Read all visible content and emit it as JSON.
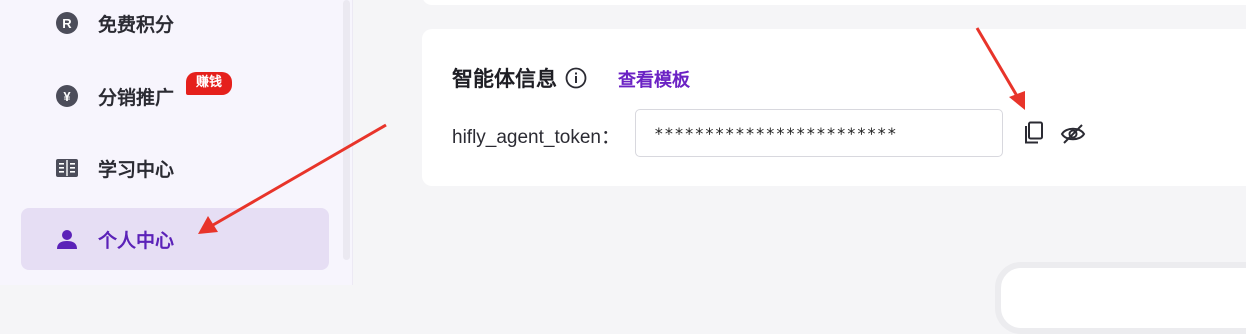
{
  "sidebar": {
    "items": [
      {
        "label": "免费积分",
        "icon": "R",
        "icon_name": "r-coin-icon"
      },
      {
        "label": "分销推广",
        "icon": "¥",
        "icon_name": "yen-coin-icon",
        "badge": "赚钱"
      },
      {
        "label": "学习中心",
        "icon_name": "book-icon"
      },
      {
        "label": "个人中心",
        "icon_name": "user-icon",
        "active": true
      }
    ]
  },
  "agent_info": {
    "title": "智能体信息",
    "view_template": "查看模板",
    "token_label": "hifly_agent_token：",
    "token_value": "************************"
  },
  "colors": {
    "accent": "#6b22c4",
    "active_bg": "#e6def4",
    "badge": "#e5201c",
    "annotation_arrow": "#e8342a"
  }
}
